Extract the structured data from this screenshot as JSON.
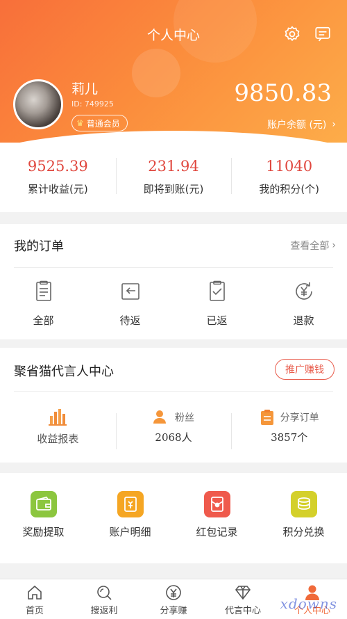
{
  "header": {
    "title": "个人中心",
    "settings_icon": "gear-icon",
    "message_icon": "message-icon"
  },
  "profile": {
    "name": "莉儿",
    "id": "ID: 749925",
    "badge": "普通会员",
    "balance": "9850.83",
    "balance_label": "账户余额 (元)"
  },
  "stats": [
    {
      "value": "9525.39",
      "label": "累计收益(元)"
    },
    {
      "value": "231.94",
      "label": "即将到账(元)"
    },
    {
      "value": "11040",
      "label": "我的积分(个)"
    }
  ],
  "orders": {
    "title": "我的订单",
    "view_all": "查看全部",
    "items": [
      {
        "label": "全部",
        "icon": "clipboard-list-icon"
      },
      {
        "label": "待返",
        "icon": "return-arrow-icon"
      },
      {
        "label": "已返",
        "icon": "clipboard-check-icon"
      },
      {
        "label": "退款",
        "icon": "yen-refund-icon"
      }
    ]
  },
  "ambassador": {
    "title": "聚省猫代言人中心",
    "promo_button": "推广赚钱",
    "report": {
      "label": "收益报表"
    },
    "fans": {
      "label": "粉丝",
      "value": "2068人"
    },
    "share_orders": {
      "label": "分享订单",
      "value": "3857个"
    }
  },
  "tools": [
    {
      "label": "奖励提取",
      "icon": "wallet-icon",
      "color": "#8cc63f"
    },
    {
      "label": "账户明细",
      "icon": "ledger-icon",
      "color": "#f5a623"
    },
    {
      "label": "红包记录",
      "icon": "red-envelope-icon",
      "color": "#ef5a4c"
    },
    {
      "label": "积分兑换",
      "icon": "coin-stack-icon",
      "color": "#d4d02a"
    }
  ],
  "tabbar": [
    {
      "label": "首页",
      "icon": "home-icon"
    },
    {
      "label": "搜返利",
      "icon": "search-icon"
    },
    {
      "label": "分享赚",
      "icon": "share-yen-icon"
    },
    {
      "label": "代言中心",
      "icon": "diamond-icon"
    },
    {
      "label": "个人中心",
      "icon": "person-icon",
      "active": true
    }
  ],
  "colors": {
    "accent": "#f86f3a",
    "value_red": "#e0473e"
  },
  "watermark": "xdowns"
}
